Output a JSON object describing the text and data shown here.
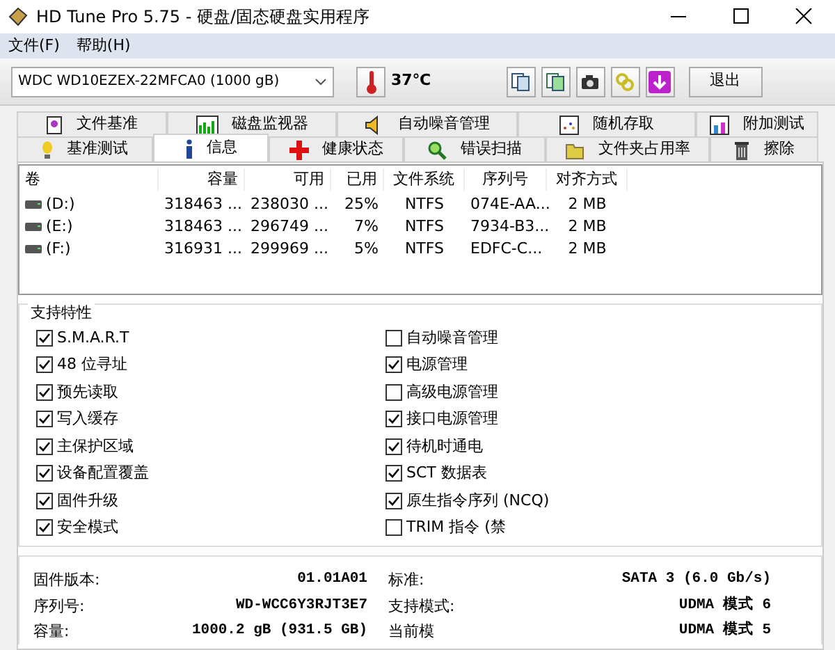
{
  "window": {
    "title": "HD Tune Pro 5.75 - 硬盘/固态硬盘实用程序"
  },
  "menu": [
    {
      "label": "文件(F)"
    },
    {
      "label": "帮助(H)"
    }
  ],
  "toolbar": {
    "drive": "WDC WD10EZEX-22MFCA0 (1000 gB)",
    "temperature": "37℃",
    "exit": "退出"
  },
  "tabs": [
    [
      {
        "label": "文件基准",
        "selected": false
      },
      {
        "label": "磁盘监视器",
        "selected": false
      },
      {
        "label": "自动噪音管理",
        "selected": false
      },
      {
        "label": "随机存取",
        "selected": false
      },
      {
        "label": "附加测试",
        "selected": false
      }
    ],
    [
      {
        "label": "基准测试",
        "selected": false
      },
      {
        "label": "信息",
        "selected": true
      },
      {
        "label": "健康状态",
        "selected": false
      },
      {
        "label": "错误扫描",
        "selected": false
      },
      {
        "label": "文件夹占用率",
        "selected": false
      },
      {
        "label": "擦除",
        "selected": false
      }
    ]
  ],
  "volumes": {
    "columns": [
      "卷",
      "容量",
      "可用",
      "已用",
      "文件系统",
      "序列号",
      "对齐方式"
    ],
    "rows": [
      [
        "(D:)",
        "318463 ...",
        "238030 ...",
        "25%",
        "NTFS",
        "074E-AA...",
        "2 MB"
      ],
      [
        "(E:)",
        "318463 ...",
        "296749 ...",
        "7%",
        "NTFS",
        "7934-B3...",
        "2 MB"
      ],
      [
        "(F:)",
        "316931 ...",
        "299969 ...",
        "5%",
        "NTFS",
        "EDFC-C...",
        "2 MB"
      ]
    ]
  },
  "features": {
    "title": "支持特性",
    "columns": [
      [
        {
          "label": "S.M.A.R.T",
          "checked": true
        },
        {
          "label": "48 位寻址",
          "checked": true
        },
        {
          "label": "预先读取",
          "checked": true
        },
        {
          "label": "写入缓存",
          "checked": true
        },
        {
          "label": "主保护区域",
          "checked": true
        },
        {
          "label": "设备配置覆盖",
          "checked": true
        },
        {
          "label": "固件升级",
          "checked": true
        },
        {
          "label": "安全模式",
          "checked": true
        }
      ],
      [
        {
          "label": "自动噪音管理",
          "checked": false
        },
        {
          "label": "电源管理",
          "checked": true
        },
        {
          "label": "高级电源管理",
          "checked": false
        },
        {
          "label": "接口电源管理",
          "checked": true
        },
        {
          "label": "待机时通电",
          "checked": true
        },
        {
          "label": "SCT 数据表",
          "checked": true
        },
        {
          "label": "原生指令序列 (NCQ)",
          "checked": true
        },
        {
          "label": "TRIM 指令 (禁",
          "checked": false
        }
      ]
    ]
  },
  "info": {
    "columns": [
      [
        {
          "label": "固件版本:",
          "value": "01.01A01"
        },
        {
          "label": "序列号:",
          "value": "WD-WCC6Y3RJT3E7"
        },
        {
          "label": "容量:",
          "value": "1000.2 gB (931.5 GB)"
        }
      ],
      [
        {
          "label": "标准:",
          "value": "SATA 3 (6.0 Gb/s)"
        },
        {
          "label": "支持模式:",
          "value": "UDMA 模式 6"
        },
        {
          "label": "当前模",
          "value": "UDMA 模式 5"
        }
      ]
    ]
  }
}
